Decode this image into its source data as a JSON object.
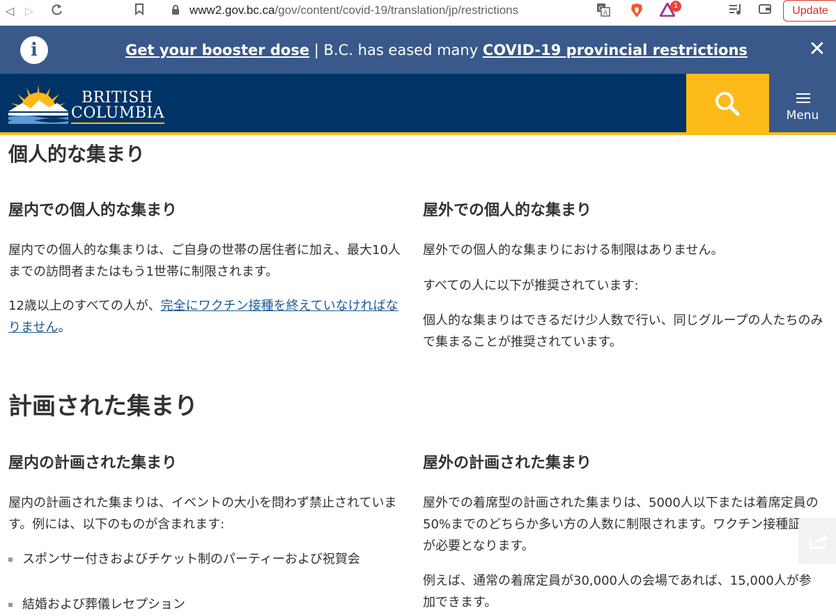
{
  "browser": {
    "url_host": "www2.gov.bc.ca",
    "url_path": "/gov/content/covid-19/translation/jp/restrictions",
    "update_label": "Update",
    "extension_badge": "1"
  },
  "alert": {
    "link1": "Get your booster dose",
    "separator": " | ",
    "text": "B.C. has eased many ",
    "link2": "COVID-19 provincial restrictions",
    "close": "✕"
  },
  "header": {
    "logo_line1": "BRITISH",
    "logo_line2": "COLUMBIA",
    "menu_label": "Menu"
  },
  "sections": {
    "personal": {
      "title": "個人的な集まり",
      "indoor": {
        "title": "屋内での個人的な集まり",
        "p1": "屋内での個人的な集まりは、ご自身の世帯の居住者に加え、最大10人までの訪問者またはもう1世帯に制限されます。",
        "p2_prefix": "12歳以上のすべての人が、",
        "p2_link": "完全にワクチン接種を終えていなければなりません",
        "p2_suffix": "。"
      },
      "outdoor": {
        "title": "屋外での個人的な集まり",
        "p1": "屋外での個人的な集まりにおける制限はありません。",
        "p2": "すべての人に以下が推奨されています:",
        "p3": "個人的な集まりはできるだけ少人数で行い、同じグループの人たちのみで集まることが推奨されています。"
      }
    },
    "planned": {
      "title": "計画された集まり",
      "indoor": {
        "title": "屋内の計画された集まり",
        "p1": "屋内の計画された集まりは、イベントの大小を問わず禁止されています。例には、以下のものが含まれます:",
        "bullets": [
          "スポンサー付きおよびチケット制のパーティーおよび祝賀会",
          "結婚および葬儀レセプション"
        ]
      },
      "outdoor": {
        "title": "屋外の計画された集まり",
        "p1": "屋外での着席型の計画された集まりは、5000人以下または着席定員の50%までのどちらか多い方の人数に制限されます。ワクチン接種証明が必要となります。",
        "p2": "例えば、通常の着席定員が30,000人の会場であれば、15,000人が参加できます。"
      }
    }
  }
}
